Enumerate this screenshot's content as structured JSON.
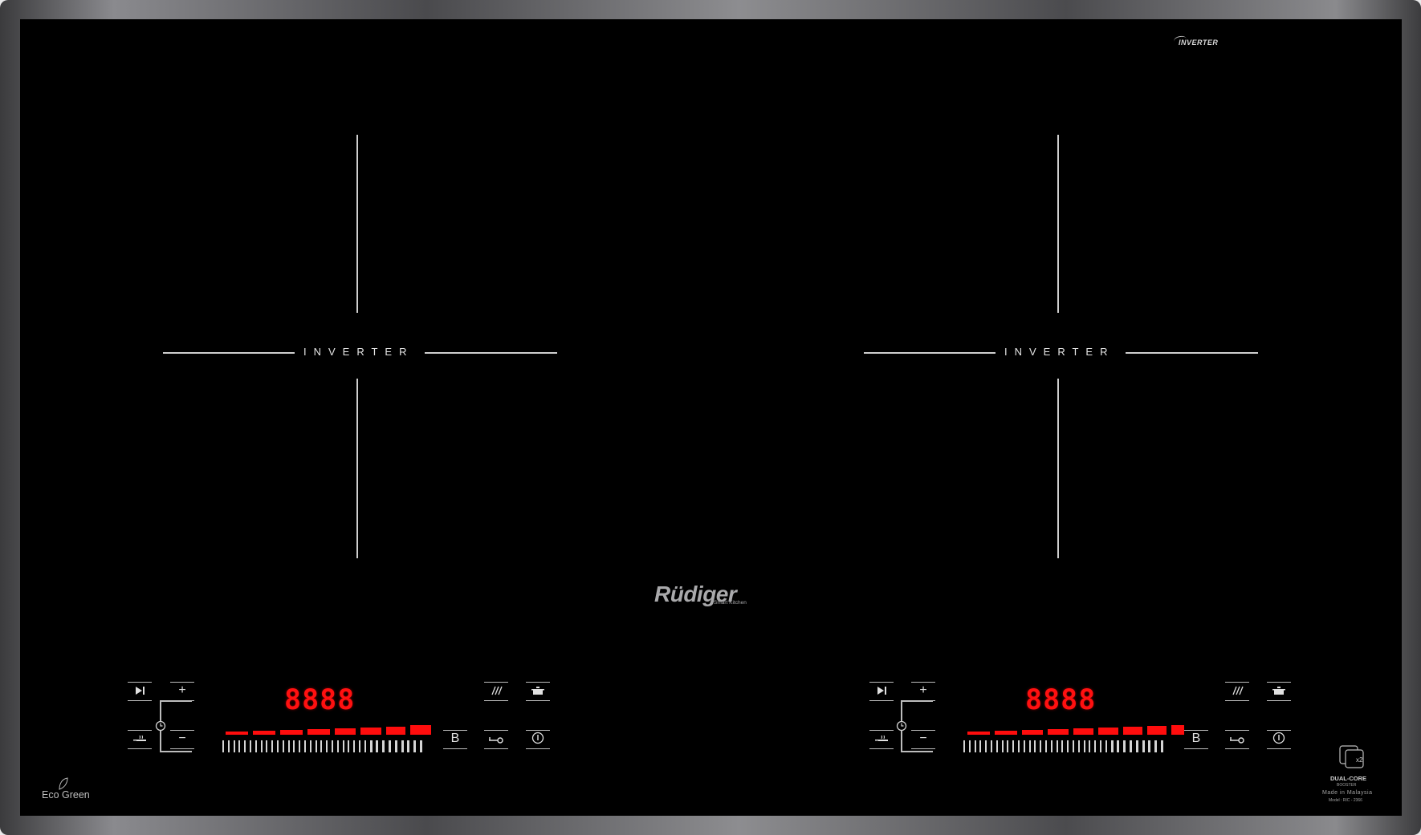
{
  "top_badge": "INVERTER",
  "zones": [
    {
      "label": "INVERTER",
      "display": "8888"
    },
    {
      "label": "INVERTER",
      "display": "8888"
    }
  ],
  "logo": {
    "name": "Rüdiger",
    "tagline": "Smart Kitchen"
  },
  "controls": {
    "plus": "+",
    "minus": "−",
    "boost": "B"
  },
  "eco": {
    "text": "Eco Green"
  },
  "dual_core": {
    "label": "DUAL-CORE",
    "sub": "BOOSTER",
    "x2": "x2",
    "made_in": "Made in Malaysia",
    "model": "Model : RIC - 2366"
  },
  "colors": {
    "display_red": "#ff1010",
    "glass": "#000000"
  }
}
